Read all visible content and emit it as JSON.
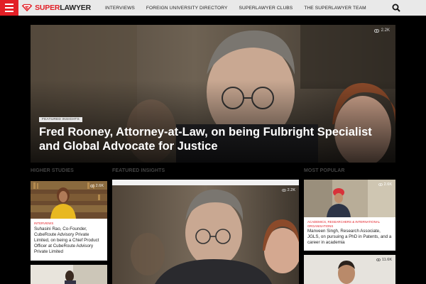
{
  "brand": {
    "logo_text_red": "SUPER",
    "logo_text_dark": "LAWYER"
  },
  "nav": {
    "items": [
      {
        "label": "INTERVIEWS"
      },
      {
        "label": "FOREIGN UNIVERSITY DIRECTORY"
      },
      {
        "label": "SUPERLAWYER CLUBS"
      },
      {
        "label": "THE SUPERLAWYER TEAM"
      }
    ]
  },
  "hero": {
    "views": "2.2K",
    "tag": "FEATURED INSIGHTS",
    "title": "Fred Rooney, Attorney-at-Law, on being Fulbright Specialist and Global Advocate for Justice"
  },
  "sections": {
    "higher_studies": "HIGHER STUDIES",
    "featured_insights": "FEATURED INSIGHTS",
    "most_popular": "MOST POPULAR"
  },
  "left_card": {
    "views": "2.6K",
    "category": "INTERVIEWS",
    "title": "Suhasini Rao, Co-Founder, CubeRoute Advisory Private Limited, on being a Chief Product Officer at CubeRoute Advisory Private Limited"
  },
  "center_card": {
    "views": "2.2K"
  },
  "right_card": {
    "views": "2.6K",
    "category": "ACADEMICS, RESEARCHERS & INTERNATIONAL ORGANISATIONS",
    "title": "Manveen Singh, Research Associate, JGLS, on pursuing a PhD in Patents, and a career in academia"
  },
  "right_card_2": {
    "views": "11.6K"
  },
  "colors": {
    "accent": "#e21f26",
    "nav_bg": "#e9e9e9",
    "page_bg": "#000000"
  }
}
